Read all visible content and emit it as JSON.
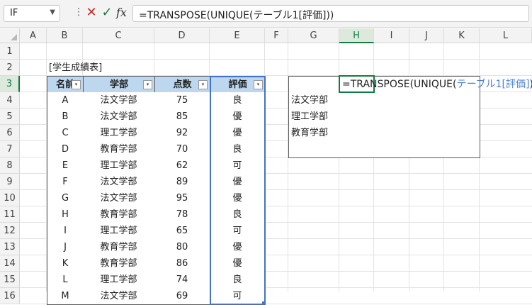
{
  "formula_bar": {
    "name_box": "IF",
    "formula": "=TRANSPOSE(UNIQUE(テーブル1[評価]))",
    "fx_label": "fx"
  },
  "columns": [
    "A",
    "B",
    "C",
    "D",
    "E",
    "F",
    "G",
    "H",
    "I",
    "J",
    "K",
    "L"
  ],
  "rows": [
    "1",
    "2",
    "3",
    "4",
    "5",
    "6",
    "7",
    "8",
    "9",
    "10",
    "11",
    "12",
    "13",
    "14",
    "15",
    "16"
  ],
  "table_title": "[学生成績表]",
  "table": {
    "headers": [
      "名前",
      "学部",
      "点数",
      "評価"
    ],
    "rows": [
      [
        "A",
        "法文学部",
        "75",
        "良"
      ],
      [
        "B",
        "法文学部",
        "85",
        "優"
      ],
      [
        "C",
        "理工学部",
        "92",
        "優"
      ],
      [
        "D",
        "教育学部",
        "70",
        "良"
      ],
      [
        "E",
        "理工学部",
        "62",
        "可"
      ],
      [
        "F",
        "法文学部",
        "89",
        "優"
      ],
      [
        "G",
        "法文学部",
        "95",
        "優"
      ],
      [
        "H",
        "教育学部",
        "78",
        "良"
      ],
      [
        "I",
        "理工学部",
        "65",
        "可"
      ],
      [
        "J",
        "教育学部",
        "80",
        "優"
      ],
      [
        "K",
        "教育学部",
        "86",
        "優"
      ],
      [
        "L",
        "理工学部",
        "74",
        "良"
      ],
      [
        "M",
        "法文学部",
        "69",
        "可"
      ]
    ]
  },
  "summary": {
    "formula_prefix": "=TRANSPOSE(UNIQUE(",
    "formula_ref": "テーブル1[評価]",
    "formula_suffix": "))",
    "labels": [
      "法文学部",
      "理工学部",
      "教育学部"
    ]
  },
  "colors": {
    "header_fill": "#bdd7ee",
    "active_green": "#107c41",
    "reference_blue": "#4472c4"
  }
}
